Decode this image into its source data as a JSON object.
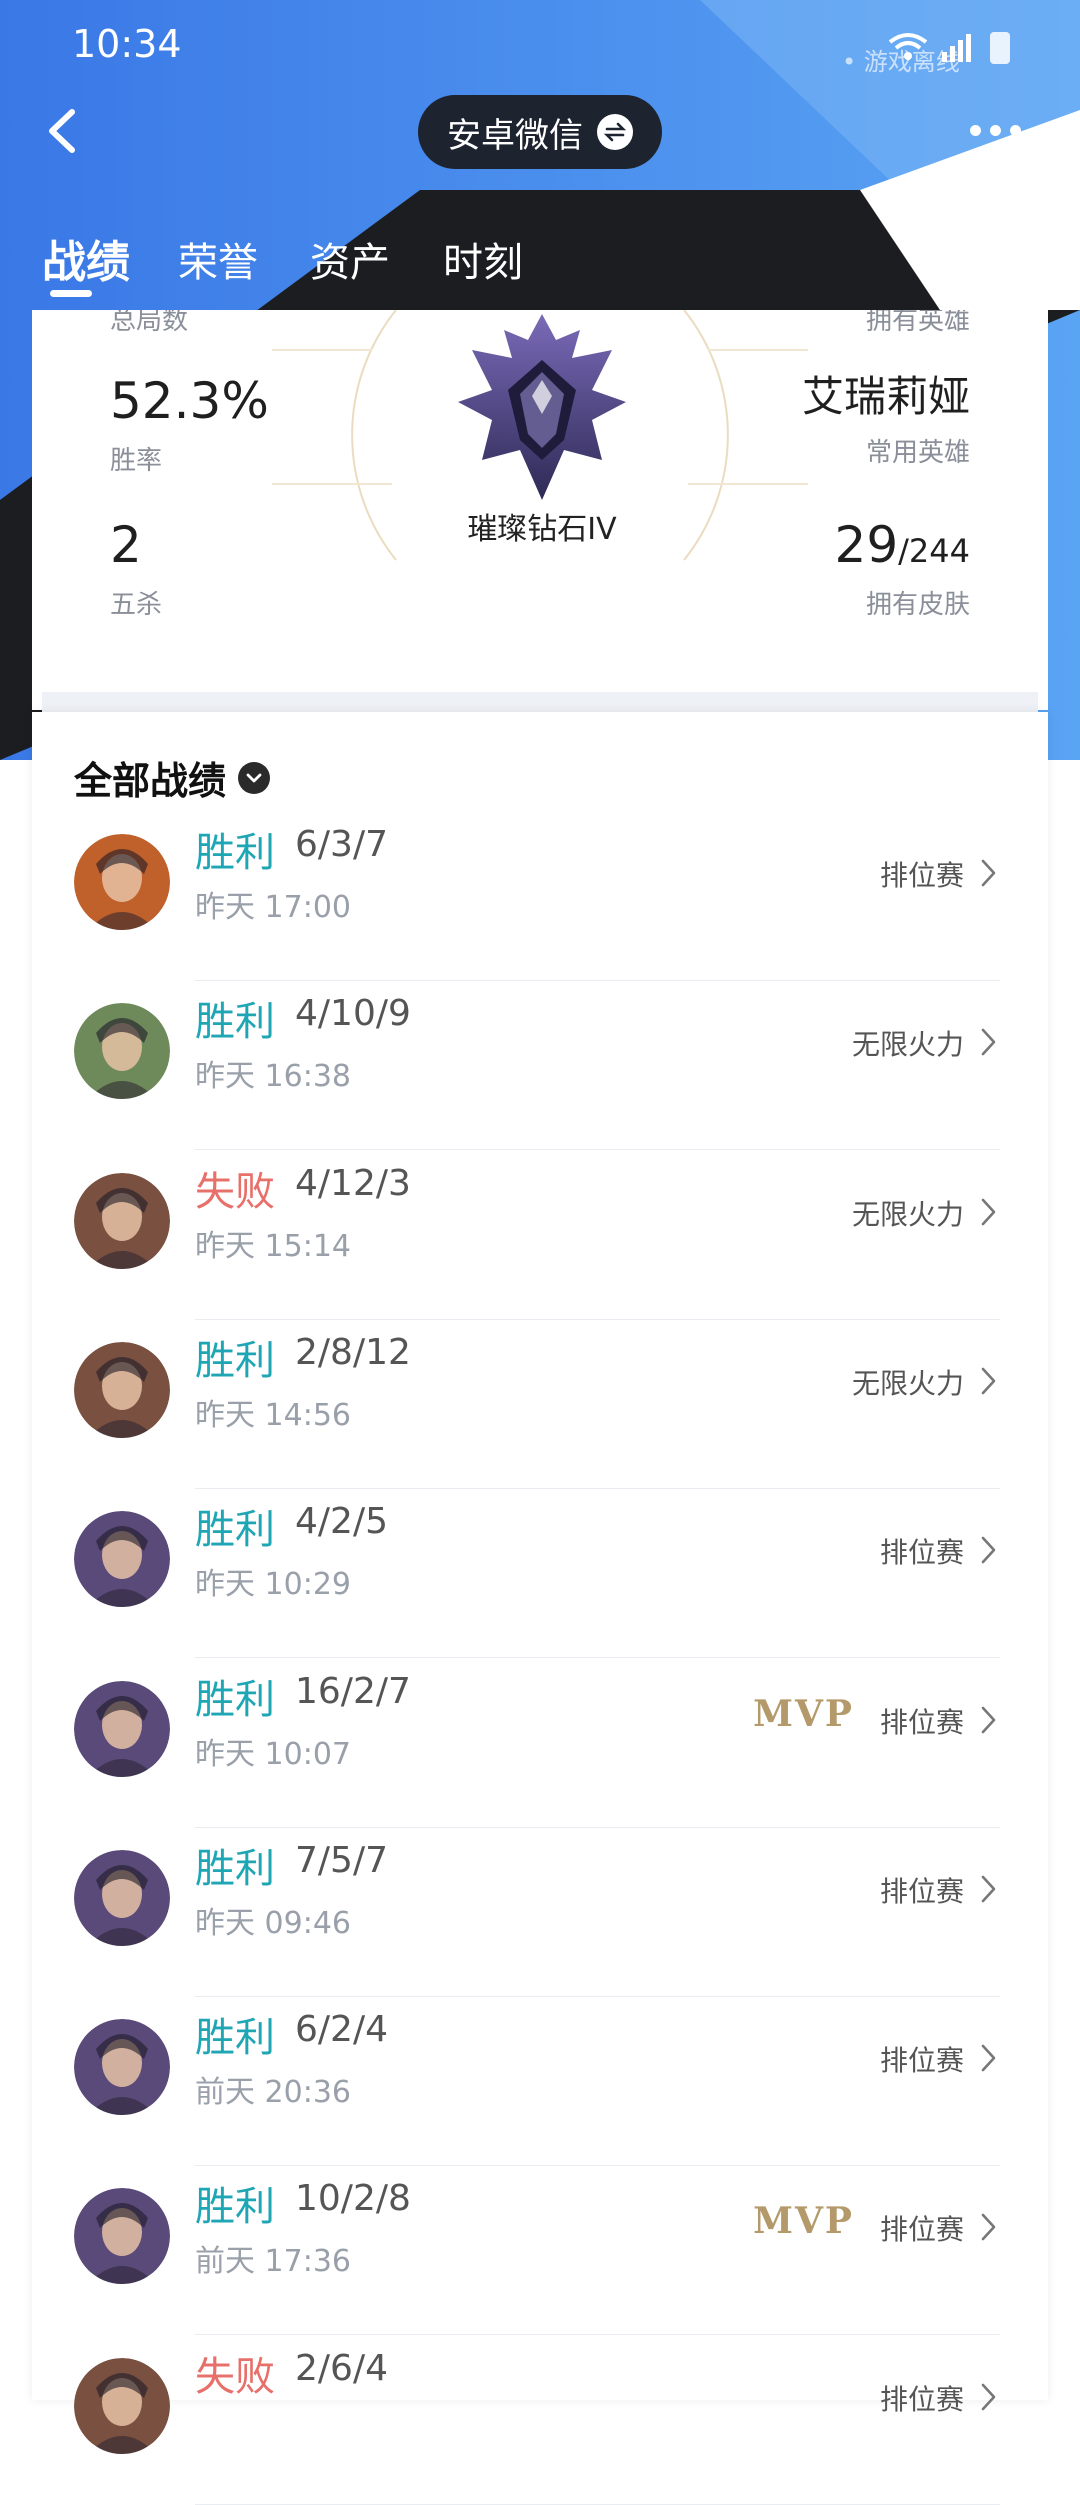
{
  "status_bar": {
    "time": "10:34",
    "extra": "• 游戏离线"
  },
  "nav": {
    "account_label": "安卓微信"
  },
  "tabs": [
    {
      "label": "战绩"
    },
    {
      "label": "荣誉"
    },
    {
      "label": "资产"
    },
    {
      "label": "时刻"
    }
  ],
  "stats": {
    "top_left_label": "总局数",
    "top_right_label": "拥有英雄",
    "win_rate": {
      "value": "52.3%",
      "label": "胜率"
    },
    "penta_kills": {
      "value": "2",
      "label": "五杀"
    },
    "favorite_champion": {
      "value": "艾瑞莉娅",
      "label": "常用英雄"
    },
    "skins": {
      "value": "29",
      "total": "/244",
      "label": "拥有皮肤"
    },
    "rank": {
      "name": "璀璨钻石IV"
    }
  },
  "list": {
    "header": "全部战绩",
    "matches": [
      {
        "result": "胜利",
        "kda": "6/3/7",
        "time": "昨天 17:00",
        "mode": "排位赛",
        "mvp": "",
        "outcome": "win",
        "avatar_color": "#c0602a"
      },
      {
        "result": "胜利",
        "kda": "4/10/9",
        "time": "昨天 16:38",
        "mode": "无限火力",
        "mvp": "",
        "outcome": "win",
        "avatar_color": "#6f8a5a"
      },
      {
        "result": "失败",
        "kda": "4/12/3",
        "time": "昨天 15:14",
        "mode": "无限火力",
        "mvp": "",
        "outcome": "loss",
        "avatar_color": "#7a5040"
      },
      {
        "result": "胜利",
        "kda": "2/8/12",
        "time": "昨天 14:56",
        "mode": "无限火力",
        "mvp": "",
        "outcome": "win",
        "avatar_color": "#7a5040"
      },
      {
        "result": "胜利",
        "kda": "4/2/5",
        "time": "昨天 10:29",
        "mode": "排位赛",
        "mvp": "",
        "outcome": "win",
        "avatar_color": "#5a4a7a"
      },
      {
        "result": "胜利",
        "kda": "16/2/7",
        "time": "昨天 10:07",
        "mode": "排位赛",
        "mvp": "MVP",
        "outcome": "win",
        "avatar_color": "#5a4a7a"
      },
      {
        "result": "胜利",
        "kda": "7/5/7",
        "time": "昨天 09:46",
        "mode": "排位赛",
        "mvp": "",
        "outcome": "win",
        "avatar_color": "#5a4a7a"
      },
      {
        "result": "胜利",
        "kda": "6/2/4",
        "time": "前天 20:36",
        "mode": "排位赛",
        "mvp": "",
        "outcome": "win",
        "avatar_color": "#5a4a7a"
      },
      {
        "result": "胜利",
        "kda": "10/2/8",
        "time": "前天 17:36",
        "mode": "排位赛",
        "mvp": "MVP",
        "outcome": "win",
        "avatar_color": "#5a4a7a"
      },
      {
        "result": "失败",
        "kda": "2/6/4",
        "time": "",
        "mode": "排位赛",
        "mvp": "",
        "outcome": "loss",
        "avatar_color": "#7a5040"
      }
    ]
  },
  "colors": {
    "win": "#1fa6b4",
    "loss": "#e8706b",
    "header_blue": "#3f7fe6",
    "header_dark": "#1c1d21"
  }
}
